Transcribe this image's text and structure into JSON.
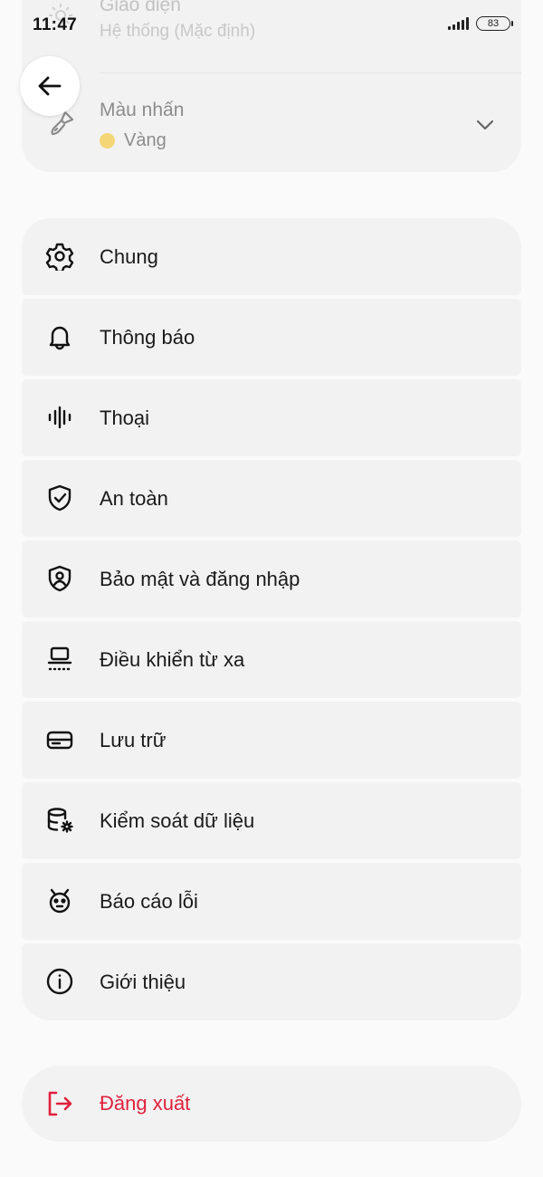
{
  "status_bar": {
    "time": "11:47",
    "battery": "83"
  },
  "appearance": {
    "title": "Giao diện",
    "value": "Hệ thống (Mặc định)"
  },
  "accent": {
    "title": "Màu nhấn",
    "value": "Vàng",
    "dot_color": "#f5d676"
  },
  "menu": {
    "items": [
      {
        "label": "Chung",
        "icon": "gear-icon"
      },
      {
        "label": "Thông báo",
        "icon": "bell-icon"
      },
      {
        "label": "Thoại",
        "icon": "voice-waveform-icon"
      },
      {
        "label": "An toàn",
        "icon": "shield-check-icon"
      },
      {
        "label": "Bảo mật và đăng nhập",
        "icon": "user-shield-icon"
      },
      {
        "label": "Điều khiển từ xa",
        "icon": "remote-control-icon"
      },
      {
        "label": "Lưu trữ",
        "icon": "storage-icon"
      },
      {
        "label": "Kiểm soát dữ liệu",
        "icon": "database-settings-icon"
      },
      {
        "label": "Báo cáo lỗi",
        "icon": "bug-icon"
      },
      {
        "label": "Giới thiệu",
        "icon": "info-icon"
      }
    ]
  },
  "logout": {
    "label": "Đăng xuất",
    "icon": "logout-icon",
    "color": "#e0203c"
  }
}
